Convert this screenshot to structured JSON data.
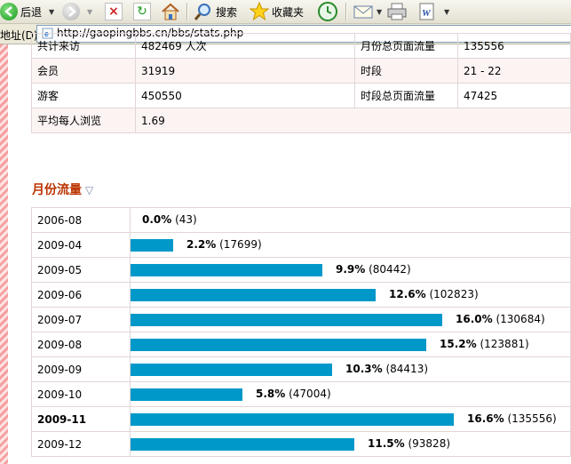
{
  "toolbar": {
    "back_label": "后退",
    "search_label": "搜索",
    "favorites_label": "收藏夹"
  },
  "address": {
    "label": "地址(D)",
    "url": "http://gaopingbbs.cn/bbs/stats.php"
  },
  "stats": {
    "rows": [
      {
        "k1": "共计来访",
        "v1": "482469 人次",
        "k2": "月份总页面流量",
        "v2": "135556"
      },
      {
        "k1": "会员",
        "v1": "31919",
        "k2": "时段",
        "v2": "21 - 22"
      },
      {
        "k1": "游客",
        "v1": "450550",
        "k2": "时段总页面流量",
        "v2": "47425"
      },
      {
        "k1": "平均每人浏览",
        "v1": "1.69",
        "k2": "",
        "v2": ""
      }
    ]
  },
  "monthly": {
    "title": "月份流量",
    "rows": [
      {
        "month": "2006-08",
        "percent": "0.0%",
        "count": "(43)"
      },
      {
        "month": "2009-04",
        "percent": "2.2%",
        "count": "(17699)"
      },
      {
        "month": "2009-05",
        "percent": "9.9%",
        "count": "(80442)"
      },
      {
        "month": "2009-06",
        "percent": "12.6%",
        "count": "(102823)"
      },
      {
        "month": "2009-07",
        "percent": "16.0%",
        "count": "(130684)"
      },
      {
        "month": "2009-08",
        "percent": "15.2%",
        "count": "(123881)"
      },
      {
        "month": "2009-09",
        "percent": "10.3%",
        "count": "(84413)"
      },
      {
        "month": "2009-10",
        "percent": "5.8%",
        "count": "(47004)"
      },
      {
        "month": "2009-11",
        "percent": "16.6%",
        "count": "(135556)"
      },
      {
        "month": "2009-12",
        "percent": "11.5%",
        "count": "(93828)"
      }
    ]
  },
  "chart_data": {
    "type": "bar",
    "title": "月份流量",
    "categories": [
      "2006-08",
      "2009-04",
      "2009-05",
      "2009-06",
      "2009-07",
      "2009-08",
      "2009-09",
      "2009-10",
      "2009-11",
      "2009-12"
    ],
    "values": [
      43,
      17699,
      80442,
      102823,
      130684,
      123881,
      84413,
      47004,
      135556,
      93828
    ],
    "percents": [
      0.0,
      2.2,
      9.9,
      12.6,
      16.0,
      15.2,
      10.3,
      5.8,
      16.6,
      11.5
    ],
    "bar_color": "#0098c9"
  },
  "colors": {
    "accent": "#bb3300",
    "bar": "#0098c9",
    "row_alt": "#fcf3f3"
  }
}
